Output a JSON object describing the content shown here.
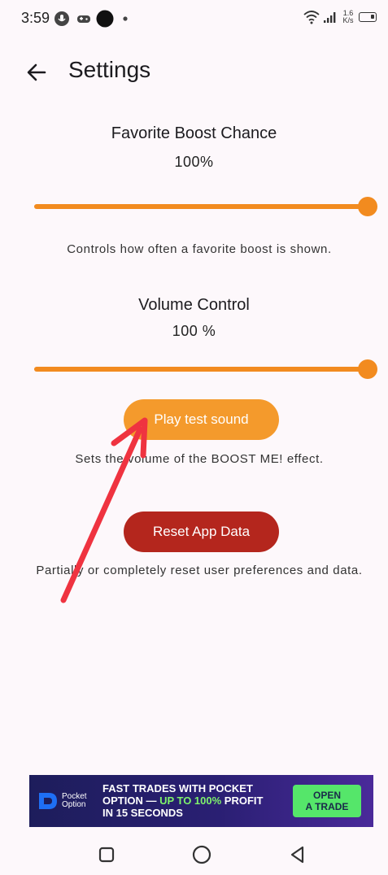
{
  "status_bar": {
    "time": "3:59",
    "net_speed_value": "1.6",
    "net_speed_unit": "K/s"
  },
  "header": {
    "title": "Settings"
  },
  "favorite_boost": {
    "title": "Favorite Boost Chance",
    "value_text": "100%",
    "level": 1.0,
    "description": "Controls how often a favorite boost is shown."
  },
  "volume": {
    "title": "Volume Control",
    "value_text": "100 %",
    "level": 1.0,
    "play_button_label": "Play test sound",
    "description": "Sets the volume of the BOOST ME! effect."
  },
  "reset": {
    "button_label": "Reset App Data",
    "description": "Partially or completely reset user preferences and data."
  },
  "ad": {
    "brand_line1": "Pocket",
    "brand_line2": "Option",
    "text_line1": "FAST TRADES WITH POCKET",
    "text_line2_a": "OPTION — ",
    "text_line2_b": "UP TO 100%",
    "text_line2_c": " PROFIT",
    "text_line3": "IN 15 SECONDS",
    "cta_line1": "OPEN",
    "cta_line2": "A TRADE"
  },
  "colors": {
    "accent": "#f28b1f",
    "play_button": "#f49a2c",
    "reset_button": "#b4261d",
    "annotation_arrow": "#ef3340",
    "background": "#fdf8fb"
  },
  "icons": {
    "back": "arrow-left-icon",
    "nav_recents": "square-icon",
    "nav_home": "circle-icon",
    "nav_back": "triangle-back-icon"
  }
}
